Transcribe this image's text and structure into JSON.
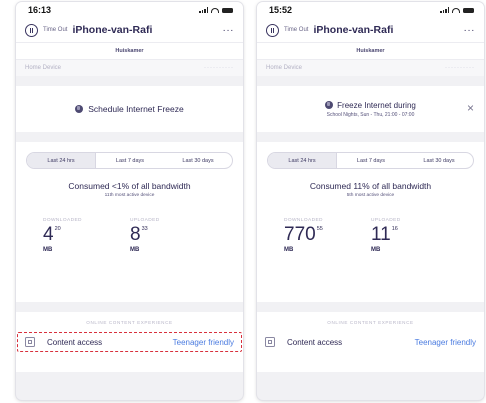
{
  "left": {
    "status_time": "16:13",
    "timeout_label": "Time Out",
    "device_name": "iPhone-van-Rafi",
    "more_label": "···",
    "room": "Huiskamer",
    "home_device_label": "Home Device",
    "home_device_value": "··········",
    "schedule_label": "Schedule Internet Freeze",
    "tabs": [
      {
        "label": "Last 24 hrs",
        "active": true
      },
      {
        "label": "Last 7 days",
        "active": false
      },
      {
        "label": "Last 30 days",
        "active": false
      }
    ],
    "consumed": "Consumed <1% of all bandwidth",
    "rank": "11th most active device",
    "downloaded_label": "DOWNLOADED",
    "downloaded_value": "4",
    "downloaded_decimal": "20",
    "downloaded_unit": "MB",
    "uploaded_label": "UPLOADED",
    "uploaded_value": "8",
    "uploaded_decimal": "33",
    "uploaded_unit": "MB",
    "content_heading": "ONLINE CONTENT EXPERIENCE",
    "content_label": "Content access",
    "content_value": "Teenager friendly"
  },
  "right": {
    "status_time": "15:52",
    "timeout_label": "Time Out",
    "device_name": "iPhone-van-Rafi",
    "more_label": "···",
    "room": "Huiskamer",
    "home_device_label": "Home Device",
    "home_device_value": "··········",
    "freeze_title": "Freeze Internet during",
    "freeze_sub": "School Nights, Sun - Thu, 21:00 - 07:00",
    "close_label": "×",
    "tabs": [
      {
        "label": "Last 24 hrs",
        "active": true
      },
      {
        "label": "Last 7 days",
        "active": false
      },
      {
        "label": "Last 30 days",
        "active": false
      }
    ],
    "consumed": "Consumed 11% of all bandwidth",
    "rank": "5th most active device",
    "downloaded_label": "DOWNLOADED",
    "downloaded_value": "770",
    "downloaded_decimal": "55",
    "downloaded_unit": "MB",
    "uploaded_label": "UPLOADED",
    "uploaded_value": "11",
    "uploaded_decimal": "16",
    "uploaded_unit": "MB",
    "content_heading": "ONLINE CONTENT EXPERIENCE",
    "content_label": "Content access",
    "content_value": "Teenager friendly"
  },
  "colors": {
    "accent_link": "#4a7be0",
    "highlight_box": "#d8303c",
    "text_primary": "#2f2a55",
    "background": "#f1f1f4"
  }
}
